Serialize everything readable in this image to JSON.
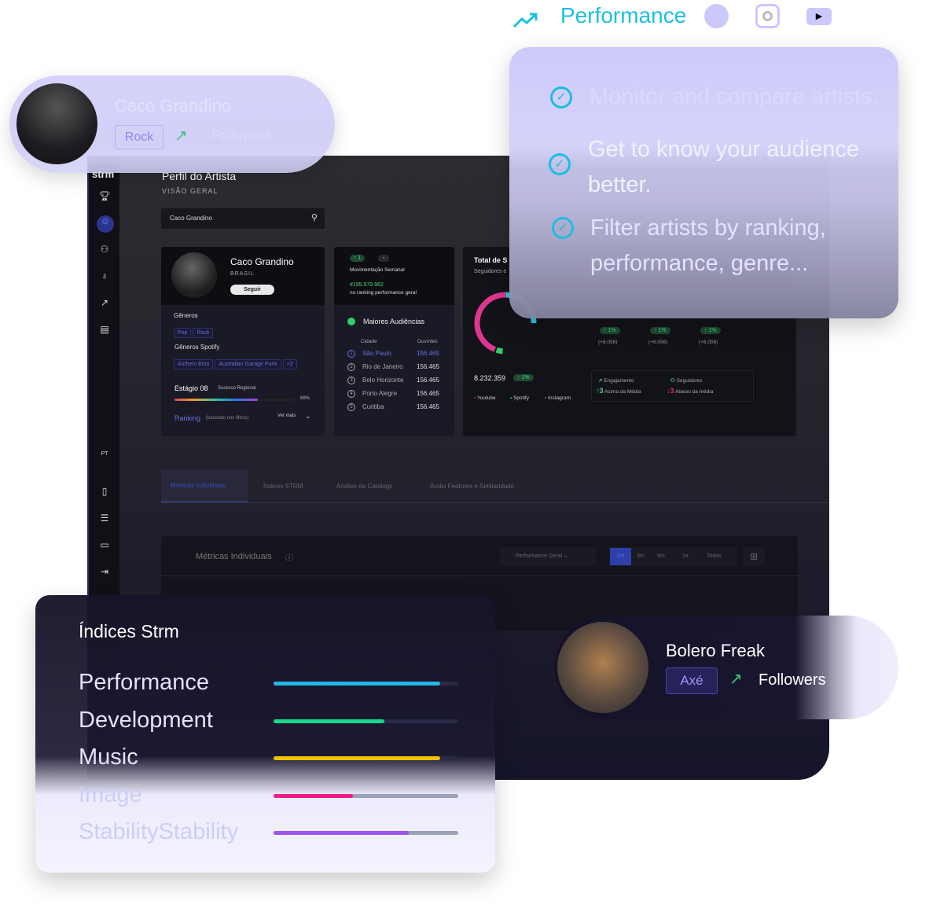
{
  "top_bar": {
    "title": "Performance",
    "icons": [
      "trending-up-icon",
      "spotify-icon",
      "instagram-icon",
      "youtube-icon"
    ],
    "accent": "#1bbfe0"
  },
  "artist_pill": {
    "name": "Caco Grandino",
    "genre": "Rock",
    "metric": "Followers"
  },
  "features": [
    "Monitor and compare artists.",
    "Get to know your audience better.",
    "Filter artists by ranking, performance, genre..."
  ],
  "dashboard": {
    "logo": "strm",
    "title": "Perfil do Artista",
    "subtitle": "VISÃO GERAL",
    "search_value": "Caco Grandino",
    "lang": "PT",
    "profile": {
      "name": "Caco Grandino",
      "country": "BRASIL",
      "follow": "Seguir",
      "genres_label": "Gêneros",
      "genres": [
        "Pop",
        "Rock"
      ],
      "spotify_label": "Gêneros Spotify",
      "spotify_genres": [
        "Anthem Emo",
        "Australian Garage Punk",
        "+2"
      ],
      "stage": "Estágio 08",
      "stage_desc": "Sucesso Regional",
      "stage_pct": "69%",
      "ranking": "Ranking",
      "ranking_note": "(baseado nos filtros)",
      "more": "Ver mais"
    },
    "movement": {
      "up": "1",
      "other": "-",
      "label": "Movimentação Semanal",
      "rank": "#195.979.962",
      "rank_label": "no ranking performance geral"
    },
    "audience": {
      "title": "Maiores Audiências",
      "col_city": "Cidade",
      "col_listeners": "Ouvintes",
      "rows": [
        [
          "1",
          "São Paulo",
          "156.465"
        ],
        [
          "2",
          "Rio de Janeiro",
          "156.465"
        ],
        [
          "3",
          "Belo Horizonte",
          "156.465"
        ],
        [
          "4",
          "Porto Alegre",
          "156.465"
        ],
        [
          "5",
          "Curitiba",
          "156.465"
        ]
      ]
    },
    "totals": {
      "title": "Total de S",
      "subtitle": "Seguidores e",
      "total": "8.232.359",
      "delta": "1%",
      "legend": [
        "Youtube",
        "Spotify",
        "Instagram"
      ],
      "changes": [
        [
          "1%",
          "(+6.056)"
        ],
        [
          "1%",
          "(+6.056)"
        ],
        [
          "1%",
          "(+6.056)"
        ]
      ],
      "engagement": "Engajamento",
      "above_n": "3",
      "above": "Acima da Média",
      "followers": "Seguidores",
      "below_n": "3",
      "below": "Abaixo da média"
    },
    "tabs": [
      "Métricas Individuais",
      "Índices STRM",
      "Análise de Catálogo",
      "Áudio Features e Similaridade"
    ],
    "metrics": {
      "title": "Métricas Individuais",
      "select": "Performance Geral",
      "ranges": [
        "1m",
        "3m",
        "6m",
        "1a",
        "Todos"
      ]
    }
  },
  "indices": {
    "title": "Índices Strm",
    "items": [
      {
        "label": "Performance",
        "value": 0.9,
        "color": "#27b6e6"
      },
      {
        "label": "Development",
        "value": 0.6,
        "color": "#18d98a"
      },
      {
        "label": "Music",
        "value": 0.9,
        "color": "#f2c200"
      },
      {
        "label": "Image",
        "value": 0.43,
        "color": "#ee1b8c"
      },
      {
        "label": "StabilityStability",
        "value": 0.73,
        "color": "#9a55f0"
      }
    ]
  },
  "artist_pill2": {
    "name": "Bolero Freak",
    "genre": "Axé",
    "metric": "Followers"
  }
}
